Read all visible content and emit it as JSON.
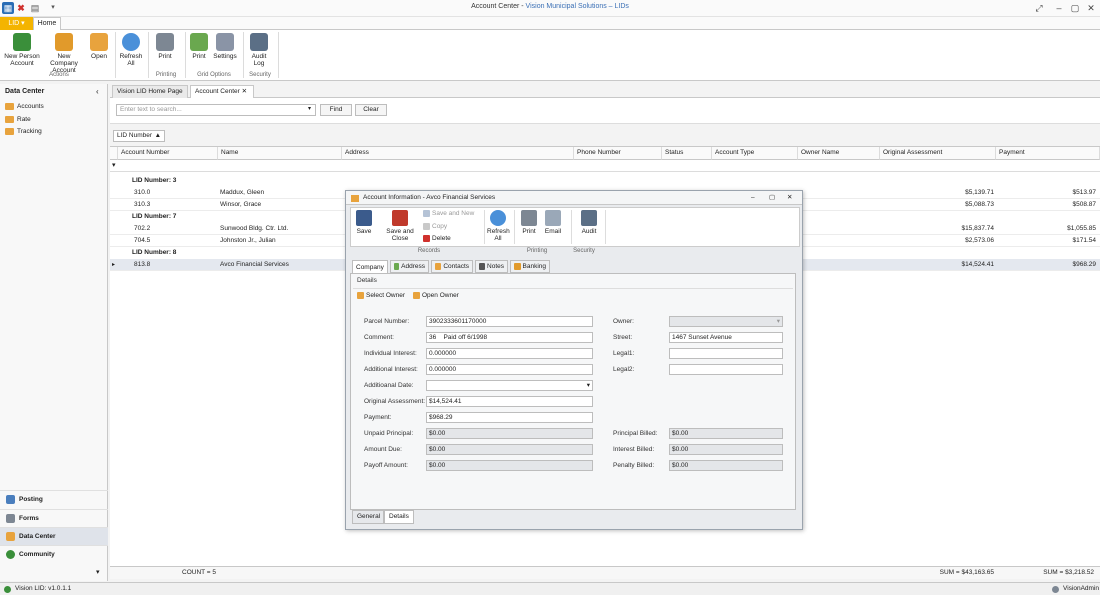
{
  "window": {
    "title_prefix": "Account Center",
    "title_separator": " - ",
    "title_app": "Vision Municipal Solutions – LIDs"
  },
  "ribbon": {
    "file_tab": "LID",
    "home_tab": "Home",
    "buttons": {
      "new_person": "New Person\nAccount",
      "new_company": "New Company\nAccount",
      "open": "Open",
      "refresh": "Refresh\nAll",
      "print1": "Print",
      "print2": "Print",
      "settings": "Settings",
      "audit": "Audit\nLog"
    },
    "groups": {
      "actions": "Actions",
      "printing": "Printing",
      "grid_options": "Grid Options",
      "security": "Security"
    }
  },
  "left_panel": {
    "header": "Data Center",
    "items": [
      "Accounts",
      "Rate",
      "Tracking"
    ],
    "nav": [
      "Posting",
      "Forms",
      "Data Center",
      "Community"
    ]
  },
  "doc_tabs": [
    "Vision LID Home Page",
    "Account Center"
  ],
  "search": {
    "placeholder": "Enter text to search...",
    "find": "Find",
    "clear": "Clear"
  },
  "group_by": "LID Number",
  "grid": {
    "columns": [
      "Account Number",
      "Name",
      "Address",
      "Phone Number",
      "Status",
      "Account Type",
      "Owner Name",
      "Original Assessment",
      "Payment"
    ],
    "groups": [
      {
        "label": "LID Number: 3",
        "rows": [
          {
            "account": "310.0",
            "name": "Maddux, Gleen",
            "orig": "$5,139.71",
            "pay": "$513.97"
          },
          {
            "account": "310.3",
            "name": "Winsor, Grace",
            "orig": "$5,088.73",
            "pay": "$508.87"
          }
        ]
      },
      {
        "label": "LID Number: 7",
        "rows": [
          {
            "account": "702.2",
            "name": "Sunwood Bldg. Ctr. Ltd.",
            "orig": "$15,837.74",
            "pay": "$1,055.85"
          },
          {
            "account": "704.5",
            "name": "Johnston Jr., Julian",
            "orig": "$2,573.06",
            "pay": "$171.54"
          }
        ]
      },
      {
        "label": "LID Number: 8",
        "rows": [
          {
            "account": "813.8",
            "name": "Avco Financial Services",
            "orig": "$14,524.41",
            "pay": "$968.29"
          }
        ]
      }
    ],
    "count": "COUNT = 5",
    "sum_orig": "SUM = $43,163.65",
    "sum_pay": "SUM = $3,218.52"
  },
  "status": {
    "version": "Vision LID: v1.0.1.1",
    "user": "VisionAdmin"
  },
  "dialog": {
    "title": "Account Information - Avco Financial Services",
    "buttons": {
      "save": "Save",
      "save_close": "Save and\nClose",
      "save_new": "Save and New",
      "copy": "Copy",
      "delete": "Delete",
      "refresh": "Refresh\nAll",
      "print": "Print",
      "email": "Email",
      "audit": "Audit"
    },
    "groups": {
      "records": "Records",
      "printing": "Printing",
      "security": "Security"
    },
    "tabs": [
      "Company",
      "Address",
      "Contacts",
      "Notes",
      "Banking"
    ],
    "details_label": "Details",
    "select_owner": "Select Owner",
    "open_owner": "Open Owner",
    "fields": {
      "parcel_label": "Parcel Number:",
      "parcel": "3902333601170000",
      "comment_label": "Comment:",
      "comment": "36    Paid off 6/1998",
      "ind_label": "Individual Interest:",
      "ind": "0.000000",
      "add_label": "Additional Interest:",
      "add": "0.000000",
      "adddate_label": "Additioanal Date:",
      "adddate": "",
      "orig_label": "Original Assessment:",
      "orig": "$14,524.41",
      "pay_label": "Payment:",
      "pay": "$968.29",
      "unpaid_label": "Unpaid Principal:",
      "unpaid": "$0.00",
      "due_label": "Amount Due:",
      "due": "$0.00",
      "payoff_label": "Payoff Amount:",
      "payoff": "$0.00",
      "owner_label": "Owner:",
      "owner": "",
      "street_label": "Street:",
      "street": "1467 Sunset Avenue",
      "legal1_label": "Legal1:",
      "legal1": "",
      "legal2_label": "Legal2:",
      "legal2": "",
      "pbilled_label": "Principal Billed:",
      "pbilled": "$0.00",
      "ibilled_label": "Interest Billed:",
      "ibilled": "$0.00",
      "penbilled_label": "Penalty Billed:",
      "penbilled": "$0.00"
    },
    "bottom_tabs": [
      "General",
      "Details"
    ]
  }
}
